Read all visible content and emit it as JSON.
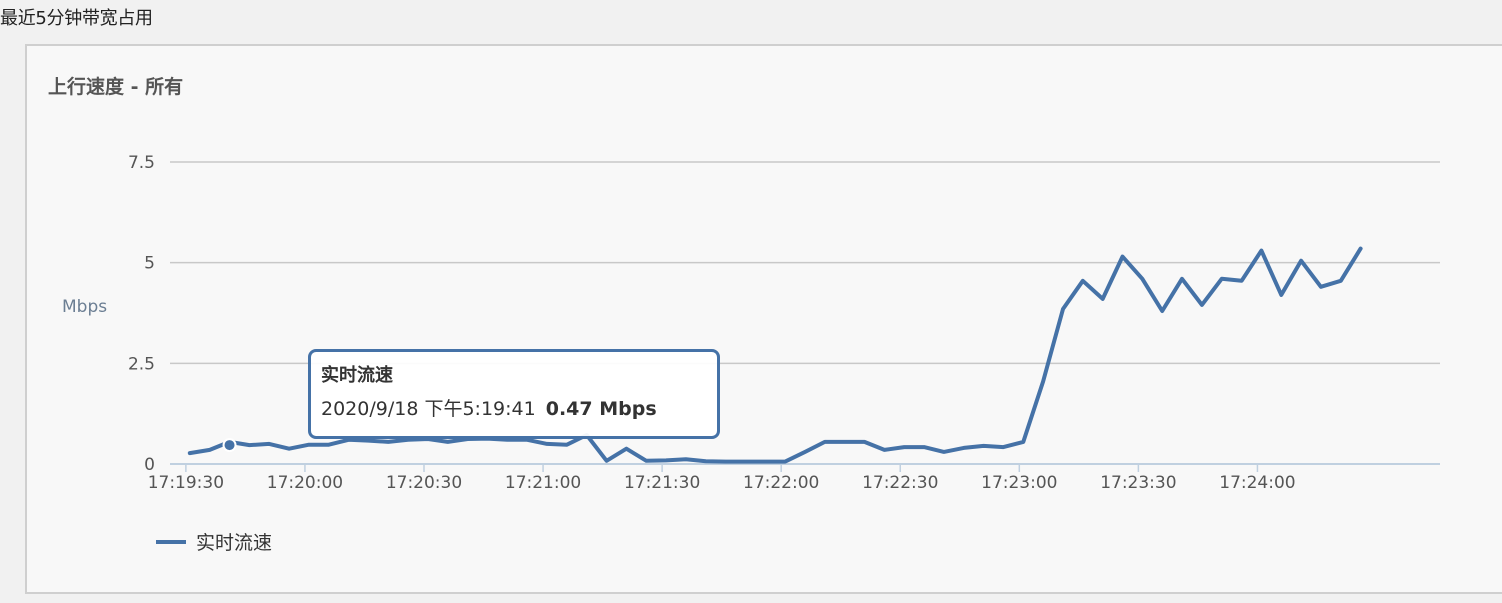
{
  "page": {
    "section_title": "最近5分钟带宽占用"
  },
  "chart_data": {
    "type": "line",
    "title": "上行速度 - 所有",
    "ylabel": "Mbps",
    "xlabel": "",
    "ylim": [
      0,
      7.5
    ],
    "yticks": [
      "0",
      "2.5",
      "5",
      "7.5"
    ],
    "yticks_values": [
      0,
      2.5,
      5,
      7.5
    ],
    "xlim_seconds": [
      "17:19:26",
      "17:24:46"
    ],
    "xticks": [
      "17:19:30",
      "17:20:00",
      "17:20:30",
      "17:21:00",
      "17:21:30",
      "17:22:00",
      "17:22:30",
      "17:23:00",
      "17:23:30",
      "17:24:00"
    ],
    "grid": true,
    "legend_position": "bottom-left",
    "series": [
      {
        "name": "实时流速",
        "color": "#4572a7",
        "x": [
          "17:19:31",
          "17:19:36",
          "17:19:41",
          "17:19:46",
          "17:19:51",
          "17:19:56",
          "17:20:01",
          "17:20:06",
          "17:20:11",
          "17:20:16",
          "17:20:21",
          "17:20:26",
          "17:20:31",
          "17:20:36",
          "17:20:41",
          "17:20:46",
          "17:20:51",
          "17:20:56",
          "17:21:01",
          "17:21:06",
          "17:21:11",
          "17:21:16",
          "17:21:21",
          "17:21:26",
          "17:21:31",
          "17:21:36",
          "17:21:41",
          "17:21:46",
          "17:21:51",
          "17:21:56",
          "17:22:01",
          "17:22:06",
          "17:22:11",
          "17:22:16",
          "17:22:21",
          "17:22:26",
          "17:22:31",
          "17:22:36",
          "17:22:41",
          "17:22:46",
          "17:22:51",
          "17:22:56",
          "17:23:01",
          "17:23:06",
          "17:23:11",
          "17:23:16",
          "17:23:21",
          "17:23:26",
          "17:23:31",
          "17:23:36",
          "17:23:41",
          "17:23:46",
          "17:23:51",
          "17:23:56",
          "17:24:01",
          "17:24:06",
          "17:24:11",
          "17:24:16",
          "17:24:21",
          "17:24:26"
        ],
        "values": [
          0.27,
          0.35,
          0.55,
          0.47,
          0.5,
          0.38,
          0.48,
          0.48,
          0.6,
          0.58,
          0.55,
          0.6,
          0.62,
          0.55,
          0.62,
          0.63,
          0.6,
          0.6,
          0.5,
          0.48,
          0.72,
          0.08,
          0.38,
          0.08,
          0.09,
          0.12,
          0.07,
          0.06,
          0.06,
          0.06,
          0.06,
          0.3,
          0.55,
          0.55,
          0.55,
          0.35,
          0.42,
          0.42,
          0.3,
          0.4,
          0.45,
          0.42,
          0.55,
          2.05,
          3.85,
          4.55,
          4.1,
          5.15,
          4.6,
          3.8,
          4.6,
          3.95,
          4.6,
          4.55,
          5.3,
          4.2,
          5.05,
          4.4,
          4.55,
          5.35
        ]
      }
    ],
    "highlight": {
      "series": "实时流速",
      "x": "17:19:41",
      "value": 0.47
    }
  },
  "tooltip": {
    "series": "实时流速",
    "datetime": "2020/9/18 下午5:19:41",
    "value": "0.47 Mbps"
  }
}
